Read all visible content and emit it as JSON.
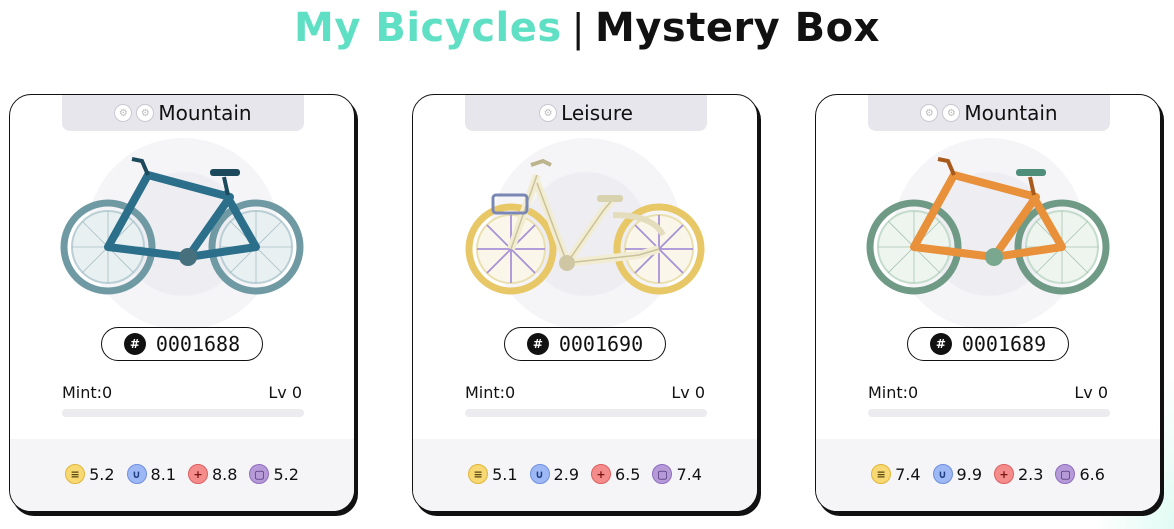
{
  "header": {
    "tab_my_bicycles": "My Bicycles",
    "separator": "|",
    "tab_mystery_box": "Mystery Box"
  },
  "cards": [
    {
      "type_label": "Mountain",
      "type_icons": [
        "wheel-icon",
        "wheel-icon"
      ],
      "id": "0001688",
      "mint_label": "Mint:0",
      "level_label": "Lv 0",
      "level_progress": 0,
      "frame_color": "#2b6f8a",
      "wheel_color": "#8fb8c2",
      "stats": {
        "efficiency": "5.2",
        "luck": "8.1",
        "comfort": "8.8",
        "resilience": "5.2"
      }
    },
    {
      "type_label": "Leisure",
      "type_icons": [
        "wheel-icon"
      ],
      "id": "0001690",
      "mint_label": "Mint:0",
      "level_label": "Lv 0",
      "level_progress": 0,
      "frame_color": "#f2ecd2",
      "wheel_color": "#e8c766",
      "stats": {
        "efficiency": "5.1",
        "luck": "2.9",
        "comfort": "6.5",
        "resilience": "7.4"
      }
    },
    {
      "type_label": "Mountain",
      "type_icons": [
        "wheel-icon",
        "wheel-icon"
      ],
      "id": "0001689",
      "mint_label": "Mint:0",
      "level_label": "Lv 0",
      "level_progress": 0,
      "frame_color": "#e8903a",
      "wheel_color": "#8fc2a6",
      "stats": {
        "efficiency": "7.4",
        "luck": "9.9",
        "comfort": "2.3",
        "resilience": "6.6"
      }
    }
  ],
  "stat_icons": {
    "efficiency": "efficiency-icon",
    "luck": "luck-icon",
    "comfort": "comfort-icon",
    "resilience": "resilience-icon"
  },
  "colors": {
    "accent": "#5fe0c4",
    "text": "#111111",
    "tab_bg": "#e6e6ec",
    "stats_bg": "#f5f5f8"
  }
}
